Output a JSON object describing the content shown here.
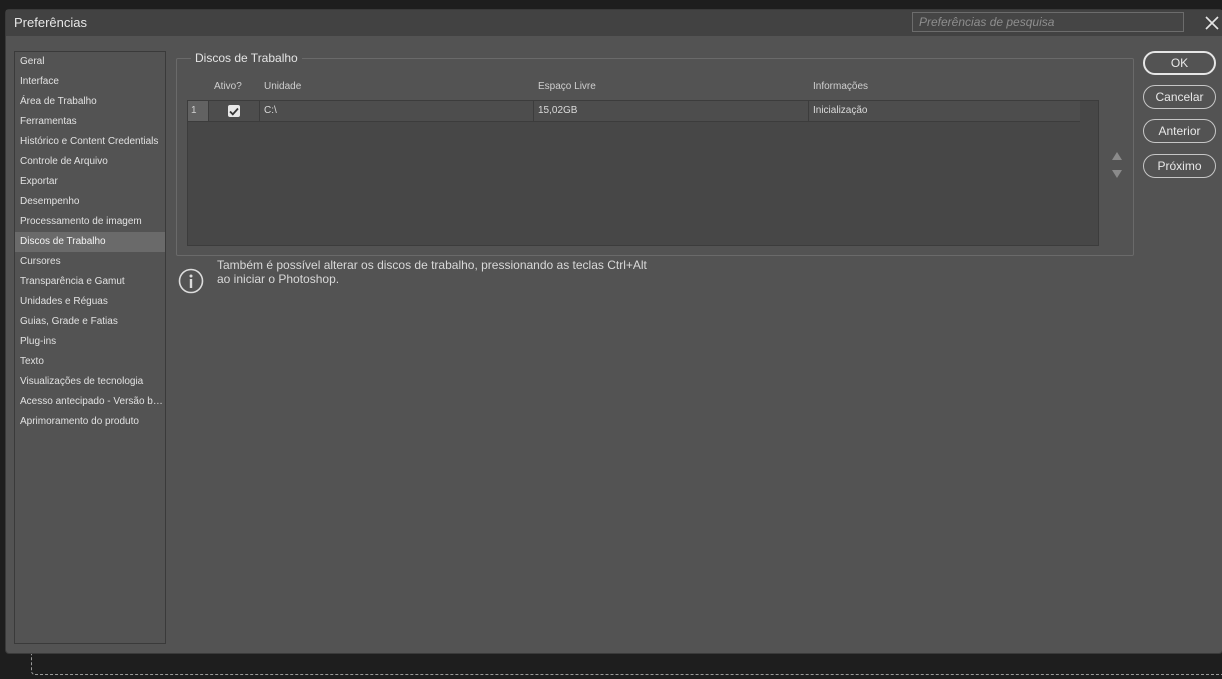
{
  "window": {
    "title": "Preferências",
    "search_placeholder": "Preferências de pesquisa"
  },
  "sidebar": {
    "items": [
      {
        "label": "Geral"
      },
      {
        "label": "Interface"
      },
      {
        "label": "Área de Trabalho"
      },
      {
        "label": "Ferramentas"
      },
      {
        "label": "Histórico e Content Credentials"
      },
      {
        "label": "Controle de Arquivo"
      },
      {
        "label": "Exportar"
      },
      {
        "label": "Desempenho"
      },
      {
        "label": "Processamento de imagem"
      },
      {
        "label": "Discos de Trabalho",
        "active": true
      },
      {
        "label": "Cursores"
      },
      {
        "label": "Transparência e Gamut"
      },
      {
        "label": "Unidades e Réguas"
      },
      {
        "label": "Guias, Grade e Fatias"
      },
      {
        "label": "Plug-ins"
      },
      {
        "label": "Texto"
      },
      {
        "label": "Visualizações de tecnologia"
      },
      {
        "label": "Acesso antecipado - Versão beta"
      },
      {
        "label": "Aprimoramento do produto"
      }
    ]
  },
  "scratch": {
    "legend": "Discos de Trabalho",
    "columns": {
      "active": "Ativo?",
      "drive": "Unidade",
      "free": "Espaço Livre",
      "info": "Informações"
    },
    "rows": [
      {
        "num": "1",
        "checked": true,
        "drive": "C:\\",
        "free": "15,02GB",
        "info": "Inicialização"
      }
    ]
  },
  "info_text": {
    "line1": "Também é possível alterar os discos de trabalho, pressionando as teclas Ctrl+Alt",
    "line2": "ao iniciar o Photoshop."
  },
  "buttons": {
    "ok": "OK",
    "cancel": "Cancelar",
    "previous": "Anterior",
    "next": "Próximo"
  }
}
